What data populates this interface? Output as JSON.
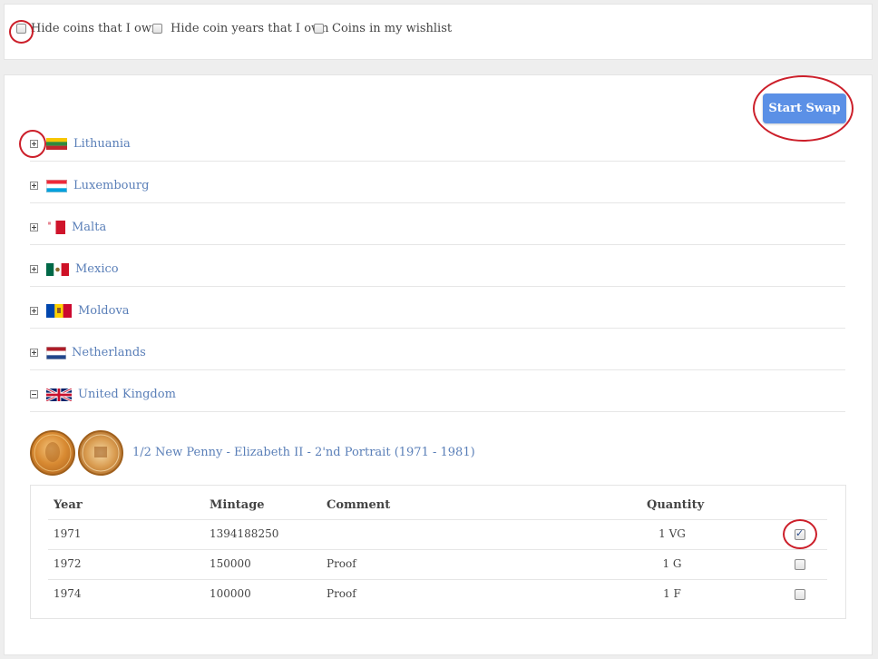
{
  "filters": [
    {
      "label": "Hide coins that I own",
      "checked": false
    },
    {
      "label": "Hide coin years that I own",
      "checked": false
    },
    {
      "label": "Coins in my wishlist",
      "checked": false
    }
  ],
  "swap_button": "Start Swap",
  "countries": [
    {
      "name": "Lithuania",
      "expanded": false
    },
    {
      "name": "Luxembourg",
      "expanded": false
    },
    {
      "name": "Malta",
      "expanded": false
    },
    {
      "name": "Mexico",
      "expanded": false
    },
    {
      "name": "Moldova",
      "expanded": false
    },
    {
      "name": "Netherlands",
      "expanded": false
    },
    {
      "name": "United Kingdom",
      "expanded": true
    }
  ],
  "coin": {
    "title": "1/2 New Penny - Elizabeth II - 2'nd Portrait (1971 - 1981)"
  },
  "table": {
    "headers": {
      "year": "Year",
      "mintage": "Mintage",
      "comment": "Comment",
      "quantity": "Quantity"
    },
    "rows": [
      {
        "year": "1971",
        "mintage": "1394188250",
        "comment": "",
        "quantity": "1 VG",
        "checked": true
      },
      {
        "year": "1972",
        "mintage": "150000",
        "comment": "Proof",
        "quantity": "1 G",
        "checked": false
      },
      {
        "year": "1974",
        "mintage": "100000",
        "comment": "Proof",
        "quantity": "1 F",
        "checked": false
      }
    ]
  },
  "colors": {
    "accent": "#5b90e6",
    "link": "#5a7fb8",
    "annotation": "#cc1f2a"
  }
}
